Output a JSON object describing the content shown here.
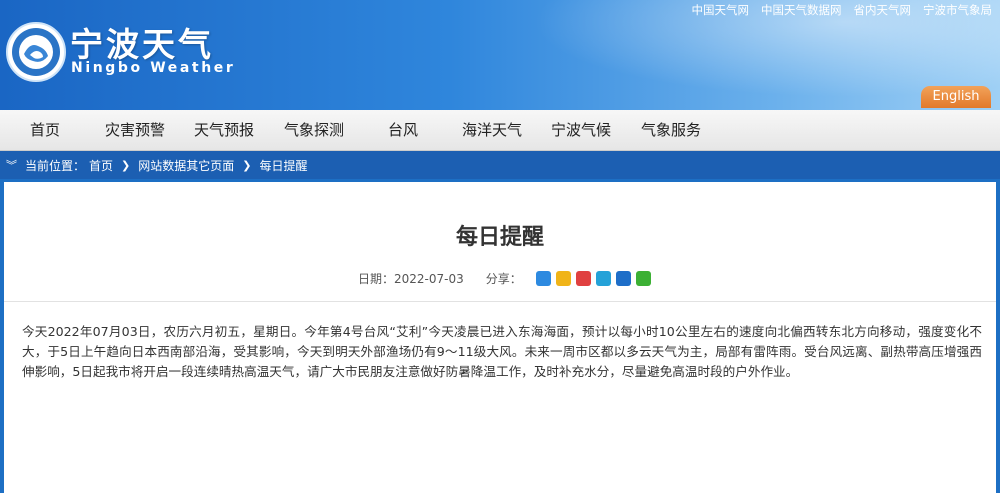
{
  "header": {
    "title": "宁波天气",
    "subtitle": "Ningbo Weather",
    "top_links": [
      "中国天气网",
      "中国天气数据网",
      "省内天气网",
      "宁波市气象局"
    ],
    "english_label": "English"
  },
  "nav": {
    "items": [
      "首页",
      "灾害预警",
      "天气预报",
      "气象探测",
      "台风",
      "海洋天气",
      "宁波气候",
      "气象服务"
    ]
  },
  "breadcrumb": {
    "prefix": "当前位置：",
    "items": [
      "首页",
      "网站数据其它页面",
      "每日提醒"
    ]
  },
  "article": {
    "title": "每日提醒",
    "date_label": "日期：",
    "date": "2022-07-03",
    "share_label": "分享：",
    "share_icons": [
      "qzone-icon",
      "weibo-star-icon",
      "sina-weibo-icon",
      "tencent-icon",
      "renren-icon",
      "wechat-icon"
    ],
    "body": "今天2022年07月03日，农历六月初五，星期日。今年第4号台风“艾利”今天凌晨已进入东海海面，预计以每小时10公里左右的速度向北偏西转东北方向移动，强度变化不大，于5日上午趋向日本西南部沿海，受其影响，今天到明天外部渔场仍有9～11级大风。未来一周市区都以多云天气为主，局部有雷阵雨。受台风远离、副热带高压增强西伸影响，5日起我市将开启一段连续晴热高温天气，请广大市民朋友注意做好防暑降温工作，及时补充水分，尽量避免高温时段的户外作业。"
  }
}
